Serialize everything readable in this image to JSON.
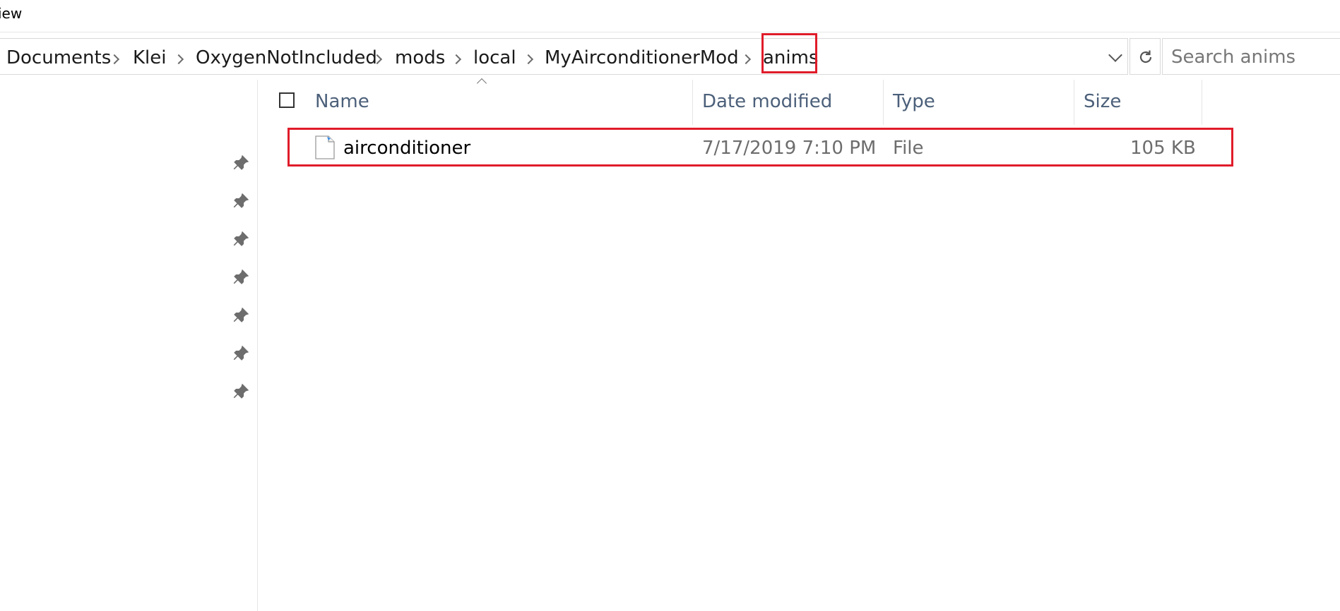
{
  "ribbon": {
    "tab_label": "iew"
  },
  "address": {
    "breadcrumbs": [
      "Documents",
      "Klei",
      "OxygenNotIncluded",
      "mods",
      "local",
      "MyAirconditionerMod",
      "anims"
    ],
    "current_folder": "anims"
  },
  "search": {
    "placeholder": "Search anims"
  },
  "columns": {
    "name": "Name",
    "date": "Date modified",
    "type": "Type",
    "size": "Size"
  },
  "files": [
    {
      "name": "airconditioner",
      "date_modified": "7/17/2019 7:10 PM",
      "type": "File",
      "size": "105 KB",
      "icon": "file-icon"
    }
  ],
  "quick_access": {
    "pinned_count": 7,
    "icon": "pin-icon"
  },
  "colors": {
    "highlight": "#e01c2a",
    "header_text": "#4c607a",
    "muted_text": "#6d6d6d"
  }
}
